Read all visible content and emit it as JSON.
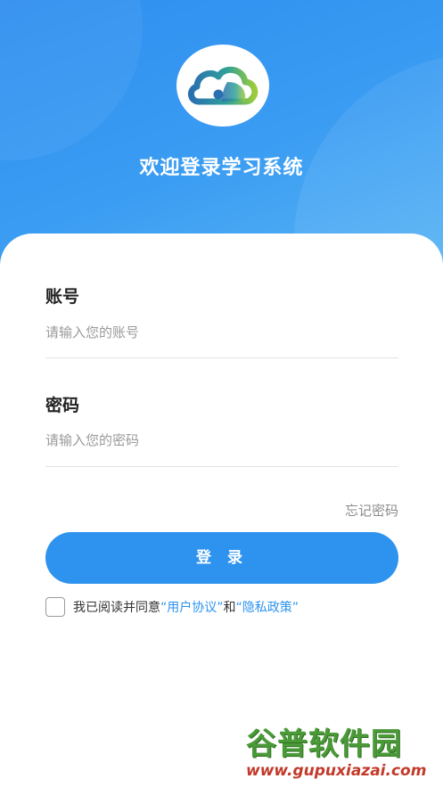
{
  "header": {
    "logo_icon": "cloud-logo-icon",
    "title": "欢迎登录学习系统",
    "gradient": [
      "#2f8ff0",
      "#56b3f5"
    ]
  },
  "form": {
    "account_label": "账号",
    "account_placeholder": "请输入您的账号",
    "account_value": "",
    "password_label": "密码",
    "password_placeholder": "请输入您的密码",
    "password_value": "",
    "forgot_label": "忘记密码",
    "login_label": "登 录"
  },
  "agreement": {
    "checked": false,
    "prefix": "我已阅读并同意",
    "user_agreement": "“用户协议”",
    "conjunction": "和",
    "privacy_policy": "“隐私政策”"
  },
  "watermark": {
    "title": "谷普软件园",
    "url": "www.gupuxiazai.com"
  },
  "colors": {
    "accent": "#2e93ef",
    "placeholder": "#9a9a9a",
    "watermark_green": "#4a9a38",
    "watermark_red": "#c23a2a"
  }
}
